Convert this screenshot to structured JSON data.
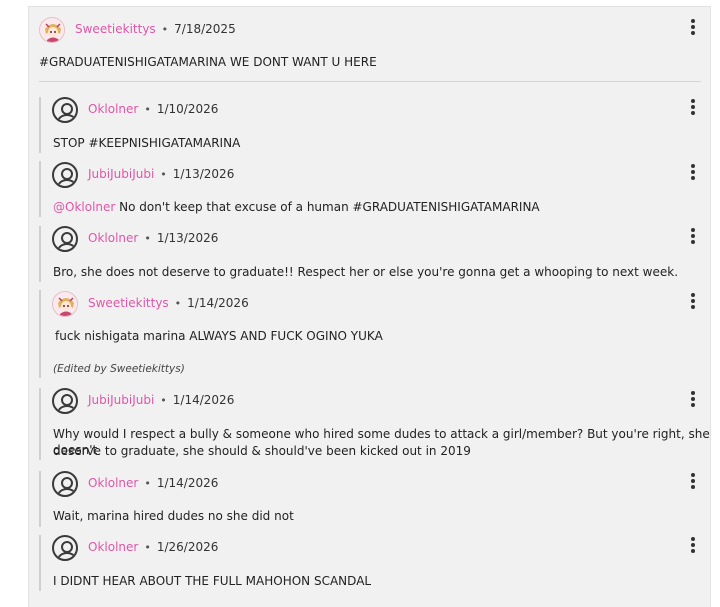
{
  "thread": {
    "root": {
      "username": "Sweetiekittys",
      "date": "7/18/2025",
      "text": "#GRADUATENISHIGATAMARINA WE DONT WANT U HERE",
      "avatar": "anime-avatar-icon",
      "menu_icon": "more-vertical-icon"
    },
    "separator": "•",
    "replies": [
      {
        "username": "Oklolner",
        "date": "1/10/2026",
        "text": "STOP #KEEPNISHIGATAMARINA",
        "avatar": "user-circle-icon"
      },
      {
        "username": "JubiJubiJubi",
        "date": "1/13/2026",
        "mention": "@Oklolner",
        "text": " No don't keep that excuse of a human #GRADUATENISHIGATAMARINA",
        "avatar": "user-circle-icon"
      },
      {
        "username": "Oklolner",
        "date": "1/13/2026",
        "text": "Bro, she does not deserve to graduate!! Respect her or else you're gonna get a whooping to next week.",
        "avatar": "user-circle-icon"
      },
      {
        "username": "Sweetiekittys",
        "date": "1/14/2026",
        "text": "fuck nishigata marina ALWAYS AND FUCK OGINO YUKA",
        "edited": "(Edited by Sweetiekittys)",
        "avatar": "anime-avatar-icon"
      },
      {
        "username": "JubiJubiJubi",
        "date": "1/14/2026",
        "text_line1": "Why would I respect a bully & someone who hired some dudes to attack a girl/member? But you're right, she doesn't",
        "text_line2": "deserve to graduate, she should & should've been kicked out in 2019",
        "avatar": "user-circle-icon"
      },
      {
        "username": "Oklolner",
        "date": "1/14/2026",
        "text": "Wait, marina hired dudes no she did not",
        "avatar": "user-circle-icon"
      },
      {
        "username": "Oklolner",
        "date": "1/26/2026",
        "text": "I DIDNT HEAR ABOUT THE FULL MAHOHON SCANDAL",
        "avatar": "user-circle-icon"
      }
    ]
  },
  "colors": {
    "username": "#e255a8",
    "background": "#f1f1f1"
  }
}
